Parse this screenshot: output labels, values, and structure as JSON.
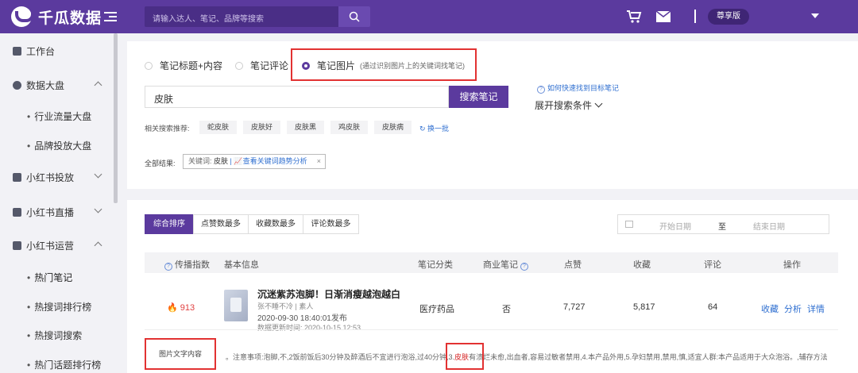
{
  "app": {
    "name": "千瓜数据",
    "search_placeholder": "请输入达人、笔记、品牌等搜索",
    "vip": "尊享版"
  },
  "sidebar": {
    "items": [
      {
        "label": "工作台"
      },
      {
        "label": "数据大盘",
        "subs": [
          "行业流量大盘",
          "品牌投放大盘"
        ]
      },
      {
        "label": "小红书投放"
      },
      {
        "label": "小红书直播"
      },
      {
        "label": "小红书运营",
        "subs": [
          "热门笔记",
          "热搜词排行榜",
          "热搜词搜索",
          "热门话题排行榜"
        ]
      }
    ]
  },
  "search": {
    "radios": [
      "笔记标题+内容",
      "笔记评论",
      "笔记图片"
    ],
    "radio_hint": "(通过识别图片上的关键词找笔记)",
    "keyword": "皮肤",
    "button": "搜索笔记",
    "help_link": "如何快速找到目标笔记",
    "expand": "展开搜索条件",
    "related_label": "相关搜索推荐:",
    "related": [
      "蛇皮肤",
      "皮肤好",
      "皮肤黑",
      "鸡皮肤",
      "皮肤病"
    ],
    "refresh": "换一批",
    "all_label": "全部结果:",
    "chip_prefix": "关键词: ",
    "chip_keyword": "皮肤",
    "chip_link": "查看关键词趋势分析",
    "chip_close": "×"
  },
  "sort": {
    "tabs": [
      "综合排序",
      "点赞数最多",
      "收藏数最多",
      "评论数最多"
    ],
    "start_date": "开始日期",
    "to": "至",
    "end_date": "结束日期"
  },
  "table": {
    "headers": [
      "传播指数",
      "基本信息",
      "笔记分类",
      "商业笔记",
      "点赞",
      "收藏",
      "评论",
      "操作"
    ],
    "row": {
      "index": "913",
      "title": "沉迷紫苏泡脚！日渐消瘦越泡越白",
      "author": "张不睡不冷 | 素人",
      "published": "2020-09-30 18:40:01发布",
      "updated": "数据更新时间:  2020-10-15 12:53",
      "category": "医疗药品",
      "commercial": "否",
      "likes": "7,727",
      "favorites": "5,817",
      "comments": "64",
      "actions": [
        "收藏",
        "分析",
        "详情"
      ]
    },
    "img_text_label": "图片文字内容",
    "ocr_before": "。注意事项:泡脚,不,2饭前饭后30分钟及醉酒后不宜进行泡浴,过40分钟,3.",
    "ocr_highlight": "皮肤",
    "ocr_after": "有溃烂未愈,出血者,容易过敏者禁用,4.本产品外用,5.孕妇禁用,禁用,慎,适宜人群:本产品适用于大众泡浴。,辅存方法"
  }
}
